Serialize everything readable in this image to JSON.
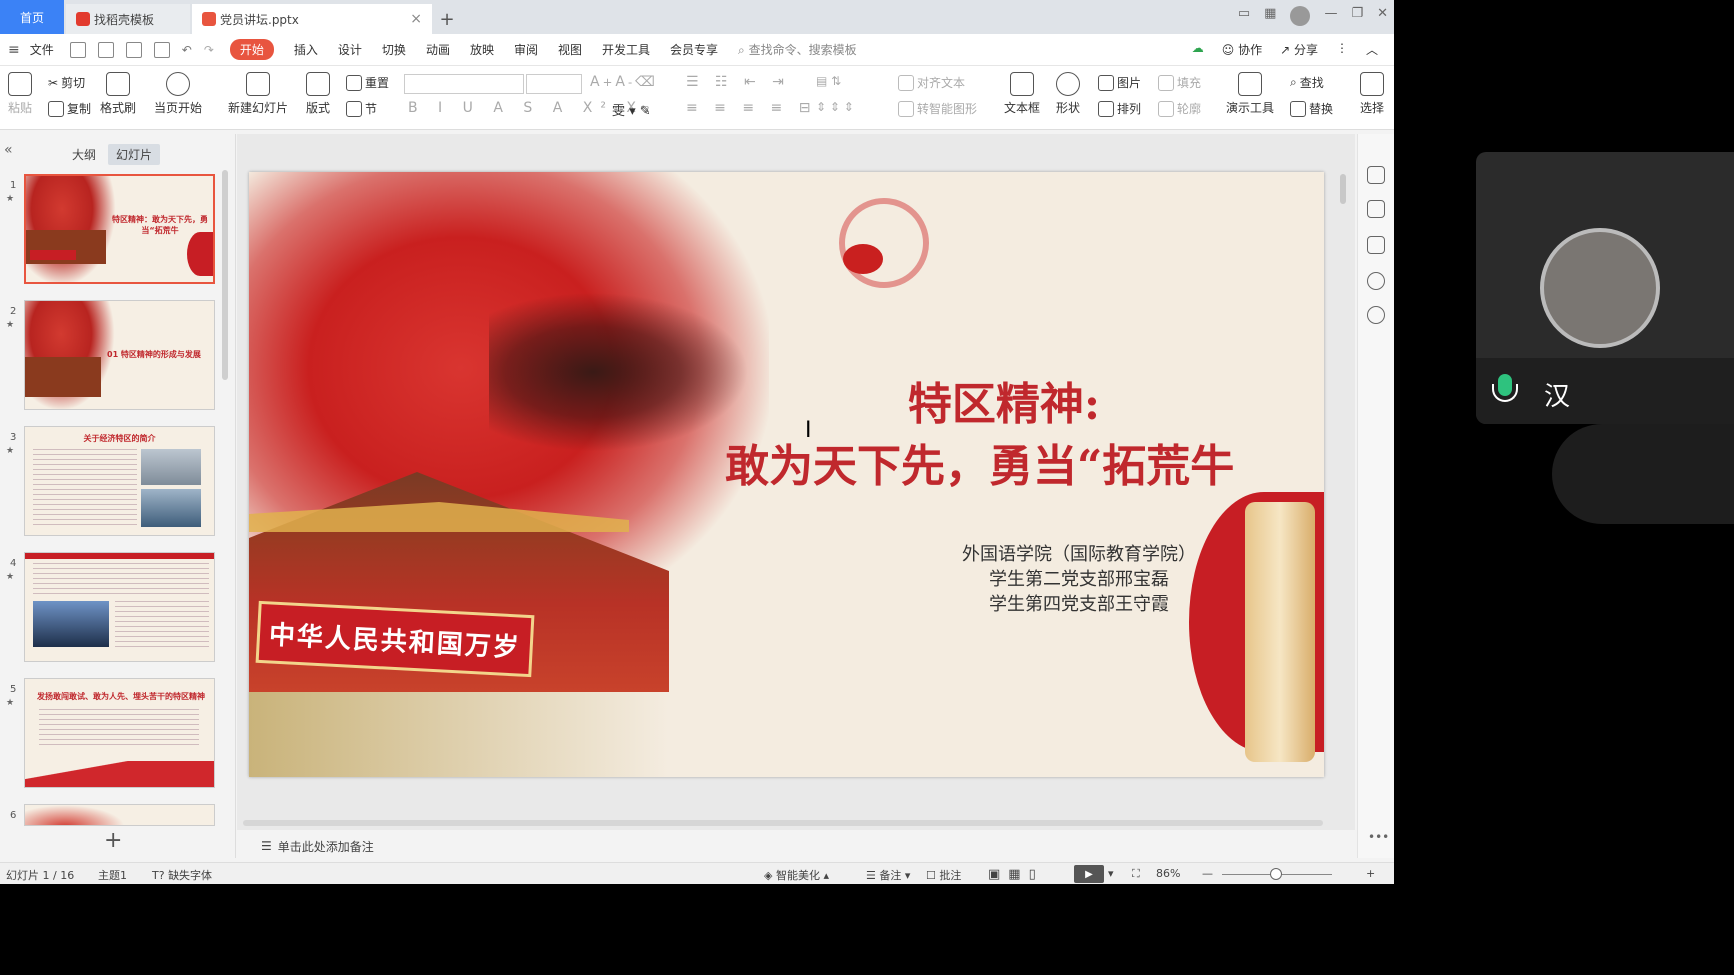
{
  "tabs": {
    "home": "首页",
    "template": "找稻壳模板",
    "file": "党员讲坛.pptx"
  },
  "menu": {
    "file": "文件",
    "items": [
      "开始",
      "插入",
      "设计",
      "切换",
      "动画",
      "放映",
      "审阅",
      "视图",
      "开发工具",
      "会员专享"
    ],
    "search": "查找命令、搜索模板",
    "collab": "协作",
    "share": "分享"
  },
  "ribbon": {
    "paste": "粘贴",
    "cut": "剪切",
    "copy": "复制",
    "format_painter": "格式刷",
    "from_current": "当页开始",
    "new_slide": "新建幻灯片",
    "layout": "版式",
    "reset": "重置",
    "section": "节",
    "text_align": "对齐文本",
    "to_smartart": "转智能图形",
    "textbox": "文本框",
    "shape": "形状",
    "picture": "图片",
    "arrange": "排列",
    "fill": "填充",
    "outline": "轮廓",
    "present_tools": "演示工具",
    "find": "查找",
    "replace": "替换",
    "select": "选择"
  },
  "left_panel": {
    "tab_outline": "大纲",
    "tab_slides": "幻灯片",
    "thumbs": [
      {
        "num": "1",
        "title": "特区精神：敢为天下先，勇当“拓荒牛"
      },
      {
        "num": "2",
        "title": "01 特区精神的形成与发展"
      },
      {
        "num": "3",
        "title": "关于经济特区的简介"
      },
      {
        "num": "4",
        "title": ""
      },
      {
        "num": "5",
        "title": "发扬敢闯敢试、敢为人先、埋头苦干的特区精神"
      },
      {
        "num": "6",
        "title": ""
      }
    ],
    "add": "+"
  },
  "slide": {
    "title_line1": "特区精神:",
    "title_line2": "敢为天下先，勇当“拓荒牛",
    "subtitle": [
      "外国语学院（国际教育学院）",
      "学生第二党支部邢宝磊",
      "学生第四党支部王守霞"
    ],
    "banner": "中华人民共和国万岁"
  },
  "notes": {
    "placeholder": "单击此处添加备注"
  },
  "status": {
    "slide_count": "幻灯片 1 / 16",
    "theme": "主题1",
    "missing_font": "缺失字体",
    "beautify": "智能美化",
    "notes": "备注",
    "comment": "批注",
    "zoom": "86%"
  },
  "voice": {
    "text": "汉"
  },
  "colors": {
    "accent": "#e8553f",
    "home_tab": "#3b82f6",
    "slide_red": "#c0282d"
  }
}
